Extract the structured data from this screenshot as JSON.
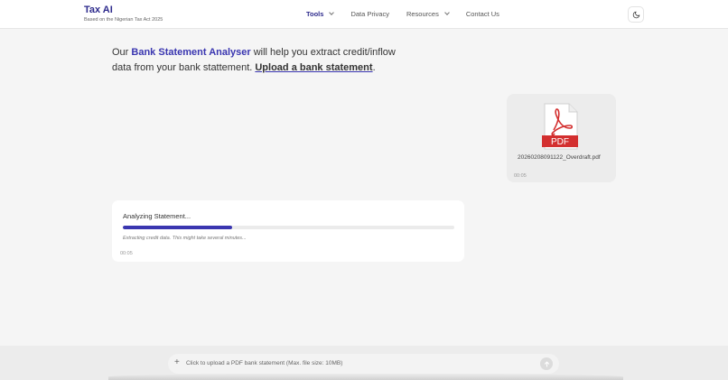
{
  "brand": {
    "title": "Tax AI",
    "subtitle": "Based on the Nigerian Tax Act 2025"
  },
  "nav": {
    "items": [
      {
        "label": "Tools",
        "active": true,
        "dropdown": true
      },
      {
        "label": "Data Privacy",
        "active": false,
        "dropdown": false
      },
      {
        "label": "Resources",
        "active": false,
        "dropdown": true
      },
      {
        "label": "Contact Us",
        "active": false,
        "dropdown": false
      }
    ],
    "theme_toggle_icon": "moon-icon"
  },
  "intro": {
    "prefix": "Our ",
    "highlight": "Bank Statement Analyser",
    "middle": " will help you extract credit/inflow data from your bank stattement. ",
    "link": "Upload a bank statement",
    "suffix": "."
  },
  "file": {
    "icon": "pdf-file-icon",
    "badge": "PDF",
    "name": "20260208091122_Overdraft.pdf",
    "time": "00:05"
  },
  "progress": {
    "title": "Analyzing Statement...",
    "fraction": 0.33,
    "note": "Extracting credit data. This might take several minutes...",
    "time": "00:05"
  },
  "upload": {
    "plus": "+",
    "placeholder": "Click to upload a PDF bank statement (Max. file size: 10MB)"
  },
  "colors": {
    "accent": "#3a36b0",
    "brand": "#2d2a8c",
    "pdf_red": "#d32f2f"
  }
}
